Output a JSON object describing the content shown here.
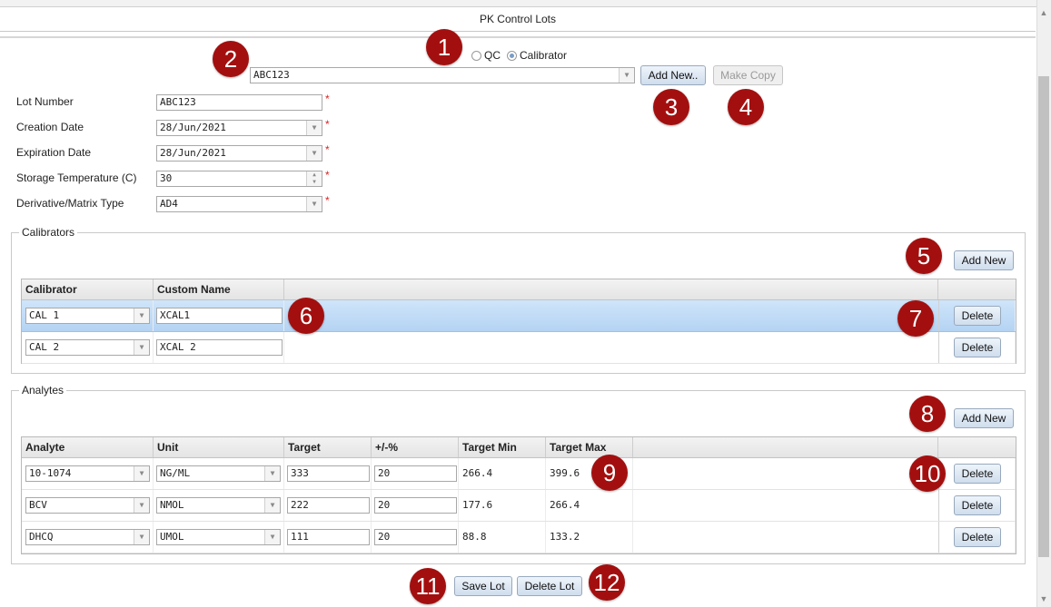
{
  "window": {
    "title": "PK Control Lots"
  },
  "lot_type": {
    "options": [
      "QC",
      "Calibrator"
    ],
    "selected": "Calibrator"
  },
  "lot_selector": {
    "value": "ABC123"
  },
  "buttons": {
    "add_new_lot": "Add New..",
    "make_copy": "Make Copy",
    "add_calibrator": "Add New",
    "add_analyte": "Add New",
    "delete": "Delete",
    "save_lot": "Save Lot",
    "delete_lot": "Delete Lot"
  },
  "form": {
    "lot_number": {
      "label": "Lot Number",
      "value": "ABC123"
    },
    "creation_date": {
      "label": "Creation Date",
      "value": "28/Jun/2021"
    },
    "expiration_date": {
      "label": "Expiration Date",
      "value": "28/Jun/2021"
    },
    "storage_temp": {
      "label": "Storage Temperature (C)",
      "value": "30"
    },
    "matrix_type": {
      "label": "Derivative/Matrix Type",
      "value": "AD4"
    },
    "required_mark": "*"
  },
  "calibrators": {
    "legend": "Calibrators",
    "columns": [
      "Calibrator",
      "Custom Name"
    ],
    "rows": [
      {
        "calibrator": "CAL 1",
        "custom_name": "XCAL1"
      },
      {
        "calibrator": "CAL 2",
        "custom_name": "XCAL 2"
      }
    ]
  },
  "analytes": {
    "legend": "Analytes",
    "columns": [
      "Analyte",
      "Unit",
      "Target",
      "+/-%",
      "Target Min",
      "Target Max"
    ],
    "rows": [
      {
        "analyte": "10-1074",
        "unit": "NG/ML",
        "target": "333",
        "pct": "20",
        "min": "266.4",
        "max": "399.6"
      },
      {
        "analyte": "BCV",
        "unit": "NMOL",
        "target": "222",
        "pct": "20",
        "min": "177.6",
        "max": "266.4"
      },
      {
        "analyte": "DHCQ",
        "unit": "UMOL",
        "target": "111",
        "pct": "20",
        "min": "88.8",
        "max": "133.2"
      }
    ]
  },
  "callouts": [
    "1",
    "2",
    "3",
    "4",
    "5",
    "6",
    "7",
    "8",
    "9",
    "10",
    "11",
    "12"
  ],
  "colors": {
    "callout": "#a30f0f",
    "selected_row": "#b4d3f3",
    "required": "#e02020"
  }
}
